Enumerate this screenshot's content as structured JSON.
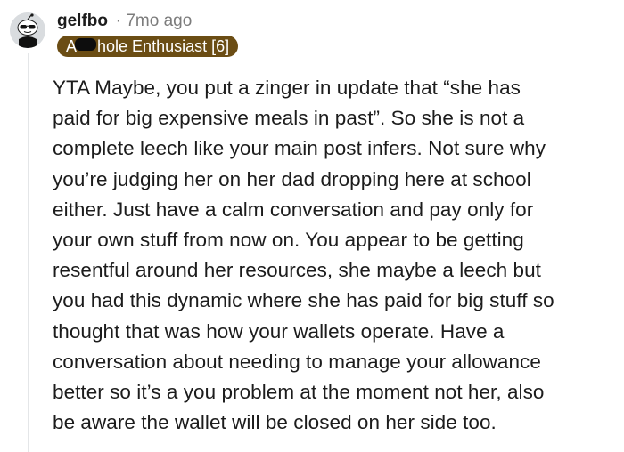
{
  "comment": {
    "author": {
      "username": "gelfbo",
      "avatar_icon": "snoo-sunglasses-avatar-icon"
    },
    "separator": "·",
    "timestamp": "7mo ago",
    "flair": {
      "prefix": "A",
      "suffix": "hole Enthusiast [6]",
      "censor_icon": "redaction-bar-icon",
      "background": "#6b4d14"
    },
    "body_lines": [
      "YTA Maybe, you put a zinger in update that “she has",
      "paid for big expensive meals in past”. So she is not a",
      "complete leech like your main post infers. Not sure why",
      "you’re judging her on her dad dropping here at school",
      "either. Just have a calm conversation and pay only for",
      "your own stuff from now on. You appear to be getting",
      "resentful around her resources, she maybe a leech but",
      "you had this dynamic where she has paid for big stuff so",
      "thought that was how your wallets operate. Have a",
      "conversation about needing to manage your allowance",
      "better so it’s a you problem at the moment not her, also",
      "be aware the wallet will be closed on her side too."
    ]
  }
}
